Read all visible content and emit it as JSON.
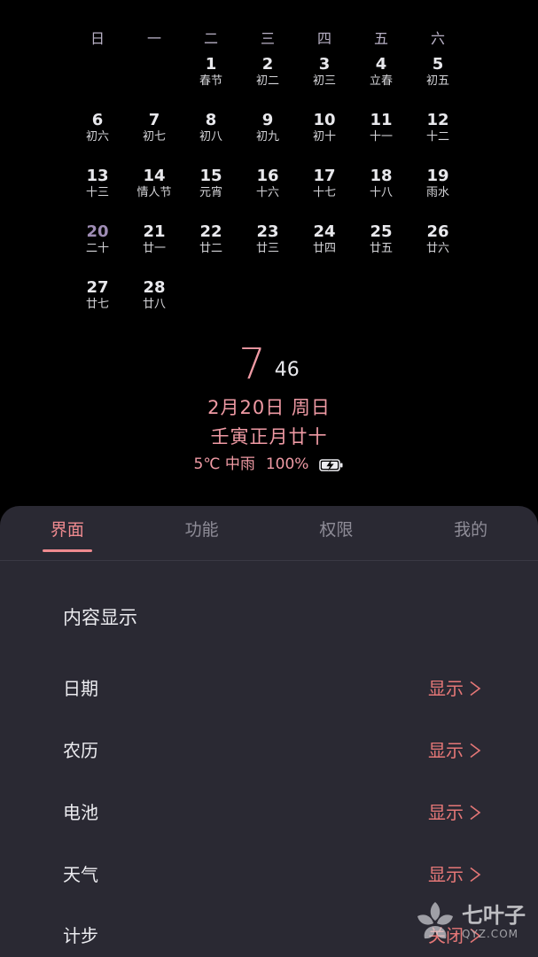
{
  "calendar": {
    "weekdays": [
      "日",
      "一",
      "二",
      "三",
      "四",
      "五",
      "六"
    ],
    "weeks": [
      [
        {
          "day": "",
          "lunar": ""
        },
        {
          "day": "",
          "lunar": ""
        },
        {
          "day": "1",
          "lunar": "春节"
        },
        {
          "day": "2",
          "lunar": "初二"
        },
        {
          "day": "3",
          "lunar": "初三"
        },
        {
          "day": "4",
          "lunar": "立春"
        },
        {
          "day": "5",
          "lunar": "初五"
        }
      ],
      [
        {
          "day": "6",
          "lunar": "初六"
        },
        {
          "day": "7",
          "lunar": "初七"
        },
        {
          "day": "8",
          "lunar": "初八"
        },
        {
          "day": "9",
          "lunar": "初九"
        },
        {
          "day": "10",
          "lunar": "初十"
        },
        {
          "day": "11",
          "lunar": "十一"
        },
        {
          "day": "12",
          "lunar": "十二"
        }
      ],
      [
        {
          "day": "13",
          "lunar": "十三"
        },
        {
          "day": "14",
          "lunar": "情人节"
        },
        {
          "day": "15",
          "lunar": "元宵"
        },
        {
          "day": "16",
          "lunar": "十六"
        },
        {
          "day": "17",
          "lunar": "十七"
        },
        {
          "day": "18",
          "lunar": "十八"
        },
        {
          "day": "19",
          "lunar": "雨水"
        }
      ],
      [
        {
          "day": "20",
          "lunar": "二十",
          "today": true
        },
        {
          "day": "21",
          "lunar": "廿一"
        },
        {
          "day": "22",
          "lunar": "廿二"
        },
        {
          "day": "23",
          "lunar": "廿三"
        },
        {
          "day": "24",
          "lunar": "廿四"
        },
        {
          "day": "25",
          "lunar": "廿五"
        },
        {
          "day": "26",
          "lunar": "廿六"
        }
      ],
      [
        {
          "day": "27",
          "lunar": "廿七"
        },
        {
          "day": "28",
          "lunar": "廿八"
        },
        {
          "day": "",
          "lunar": ""
        },
        {
          "day": "",
          "lunar": ""
        },
        {
          "day": "",
          "lunar": ""
        },
        {
          "day": "",
          "lunar": ""
        },
        {
          "day": "",
          "lunar": ""
        }
      ]
    ]
  },
  "clock": {
    "hour": "7",
    "minute": "46",
    "date": "2月20日 周日",
    "lunar_date": "壬寅正月廿十",
    "weather": "5℃ 中雨",
    "battery": "100%",
    "battery_icon": "battery-charging-icon"
  },
  "tabs": [
    {
      "label": "界面",
      "active": true
    },
    {
      "label": "功能",
      "active": false
    },
    {
      "label": "权限",
      "active": false
    },
    {
      "label": "我的",
      "active": false
    }
  ],
  "settings": {
    "section_title": "内容显示",
    "rows": [
      {
        "label": "日期",
        "value": "显示"
      },
      {
        "label": "农历",
        "value": "显示"
      },
      {
        "label": "电池",
        "value": "显示"
      },
      {
        "label": "天气",
        "value": "显示"
      },
      {
        "label": "计步",
        "value": "关闭"
      }
    ]
  },
  "watermark": {
    "name": "七叶子",
    "domain": "QYZ.COM"
  },
  "colors": {
    "accent": "#ef8a8f",
    "today": "#9f8db5",
    "panel_bg": "#2a2933",
    "background": "#000000"
  }
}
